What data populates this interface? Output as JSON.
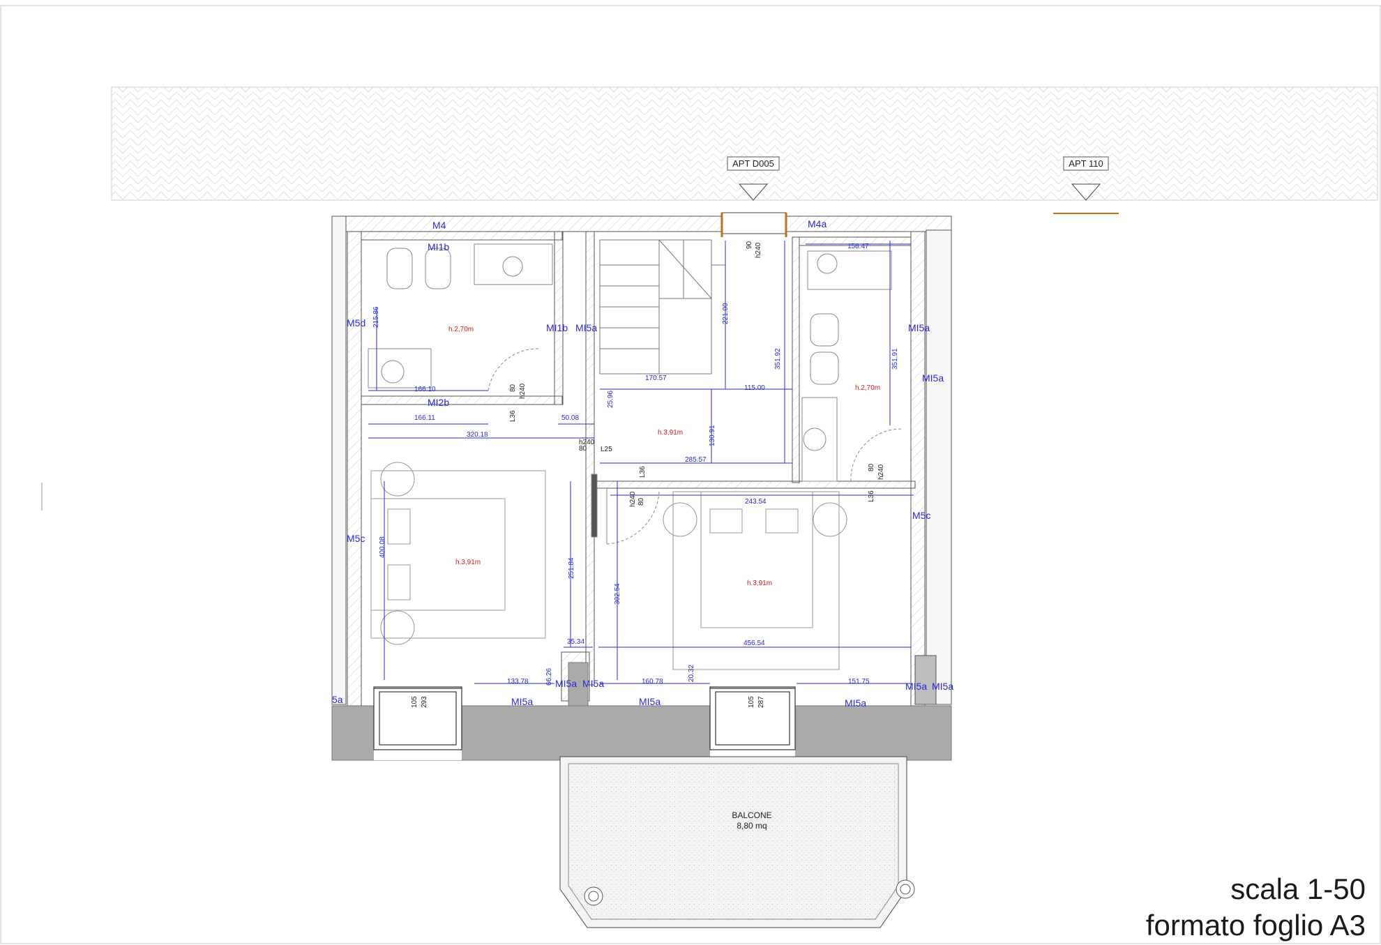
{
  "apartment_tags": [
    "APT D005",
    "APT 110"
  ],
  "wall_labels": [
    "M4",
    "MI1b",
    "M4a",
    "M5d",
    "MI1b",
    "MI5a",
    "MI5a",
    "MI5a",
    "MI2b",
    "M5c",
    "M5c",
    "MI5a",
    "MI5a",
    "MI5a",
    "MI5a",
    "MI5a",
    "MI5a",
    "MI5a",
    "5a"
  ],
  "room_heights": [
    "h.2,70m",
    "h.2,70m",
    "h.3,91m",
    "h.3,91m",
    "h.3,91m"
  ],
  "dimensions": [
    "215.86",
    "166.10",
    "166.11",
    "320.18",
    "50.08",
    "170.57",
    "115.00",
    "221.00",
    "351.92",
    "285.57",
    "130.91",
    "25.96",
    "158.47",
    "351.91",
    "400.08",
    "251.84",
    "302.54",
    "243.54",
    "456.54",
    "35.34",
    "133.78",
    "66.26",
    "160.78",
    "20.32",
    "151.75"
  ],
  "door_marks": [
    "90",
    "h240",
    "80",
    "h240",
    "L36",
    "h240",
    "80",
    "L25",
    "L36",
    "h240",
    "80",
    "80",
    "h240",
    "L36",
    "105",
    "293",
    "105",
    "287"
  ],
  "balcony": {
    "label": "BALCONE",
    "area": "8,80 mq"
  },
  "scale_note": {
    "line1": "scala 1-50",
    "line2": "formato foglio A3"
  },
  "colors": {
    "dimension": "#2a2ad0",
    "room_height": "#d02020",
    "wall_fill": "#aaaaaa",
    "door_frame": "#c07020"
  }
}
